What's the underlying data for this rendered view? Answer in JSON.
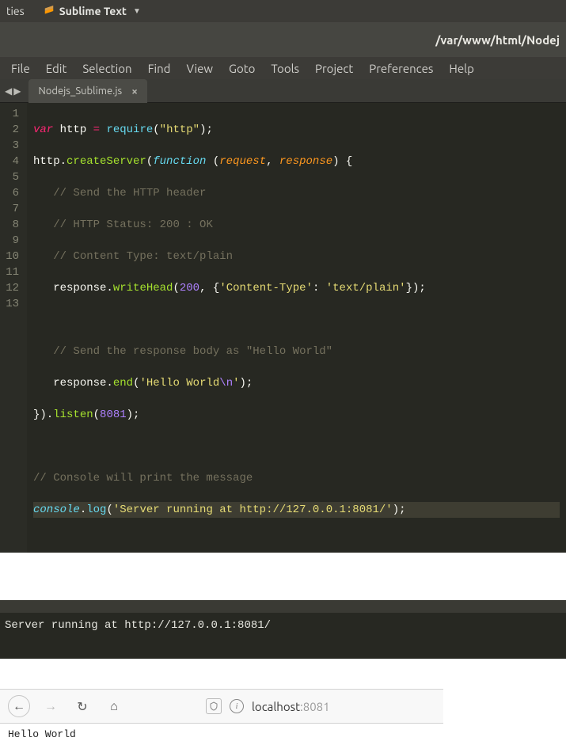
{
  "topbar": {
    "left_fragment": "ties",
    "app_name": "Sublime Text"
  },
  "window": {
    "title_path": "/var/www/html/Nodej"
  },
  "menu": {
    "items": [
      "File",
      "Edit",
      "Selection",
      "Find",
      "View",
      "Goto",
      "Tools",
      "Project",
      "Preferences",
      "Help"
    ]
  },
  "tab": {
    "filename": "Nodejs_Sublime.js"
  },
  "code": {
    "lines_count": 13,
    "raw": "var http = require(\"http\");\nhttp.createServer(function (request, response) {\n   // Send the HTTP header\n   // HTTP Status: 200 : OK\n   // Content Type: text/plain\n   response.writeHead(200, {'Content-Type': 'text/plain'});\n\n   // Send the response body as \"Hello World\"\n   response.end('Hello World\\n');\n}).listen(8081);\n\n// Console will print the message\nconsole.log('Server running at http://127.0.0.1:8081/');"
  },
  "console": {
    "output": "Server running at http://127.0.0.1:8081/"
  },
  "browser": {
    "url_host": "localhost",
    "url_port": ":8081",
    "body": "Hello World"
  }
}
